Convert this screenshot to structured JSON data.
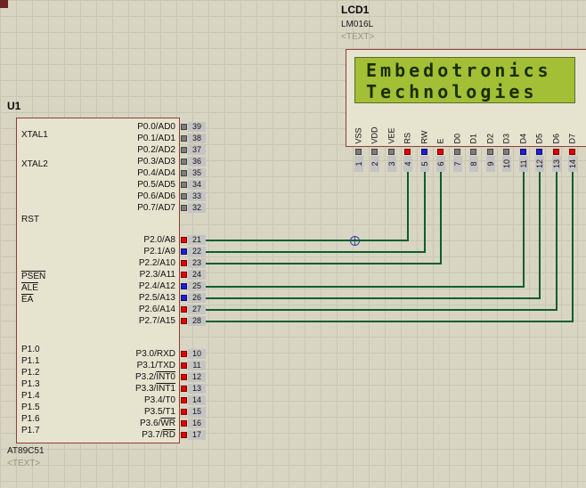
{
  "colors": {
    "background": "#d8d5c2",
    "grid_line": "#c9c6b1",
    "chip_fill": "#e6e3cf",
    "chip_border": "#8e3f38",
    "pin_box": "#c4c4c4",
    "wire_green": "#0b5e2d",
    "state_high": "#e10000",
    "state_low": "#1e1ed2",
    "state_float": "#7d7d7d",
    "lcd_screen": "#a3bf35",
    "lcd_text": "#1a2e05"
  },
  "u1": {
    "ref": "U1",
    "part": "AT89C51",
    "placeholder": "<TEXT>",
    "left_pins": [
      {
        "text": "XTAL1"
      },
      {
        "text": "XTAL2"
      },
      {
        "text": "RST"
      },
      {
        "text": "",
        "bar": "PSEN"
      },
      {
        "text": "",
        "bar": "ALE"
      },
      {
        "text": "",
        "bar": "EA"
      },
      {
        "text": "P1.0"
      },
      {
        "text": "P1.1"
      },
      {
        "text": "P1.2"
      },
      {
        "text": "P1.3"
      },
      {
        "text": "P1.4"
      },
      {
        "text": "P1.5"
      },
      {
        "text": "P1.6"
      },
      {
        "text": "P1.7"
      }
    ],
    "port0": [
      {
        "text": "P0.0/AD0",
        "number": "39",
        "state": "float"
      },
      {
        "text": "P0.1/AD1",
        "number": "38",
        "state": "float"
      },
      {
        "text": "P0.2/AD2",
        "number": "37",
        "state": "float"
      },
      {
        "text": "P0.3/AD3",
        "number": "36",
        "state": "float"
      },
      {
        "text": "P0.4/AD4",
        "number": "35",
        "state": "float"
      },
      {
        "text": "P0.5/AD5",
        "number": "34",
        "state": "float"
      },
      {
        "text": "P0.6/AD6",
        "number": "33",
        "state": "float"
      },
      {
        "text": "P0.7/AD7",
        "number": "32",
        "state": "float"
      }
    ],
    "port2": [
      {
        "text": "P2.0/A8",
        "number": "21",
        "state": "high"
      },
      {
        "text": "P2.1/A9",
        "number": "22",
        "state": "low"
      },
      {
        "text": "P2.2/A10",
        "number": "23",
        "state": "high"
      },
      {
        "text": "P2.3/A11",
        "number": "24",
        "state": "high"
      },
      {
        "text": "P2.4/A12",
        "number": "25",
        "state": "low"
      },
      {
        "text": "P2.5/A13",
        "number": "26",
        "state": "low"
      },
      {
        "text": "P2.6/A14",
        "number": "27",
        "state": "high"
      },
      {
        "text": "P2.7/A15",
        "number": "28",
        "state": "high"
      }
    ],
    "port3": [
      {
        "text": "P3.0/RXD",
        "number": "10",
        "state": "high"
      },
      {
        "text": "P3.1/TXD",
        "number": "11",
        "state": "high"
      },
      {
        "text": "P3.2/",
        "bar": "INT0",
        "number": "12",
        "state": "high"
      },
      {
        "text": "P3.3/",
        "bar": "INT1",
        "number": "13",
        "state": "high"
      },
      {
        "text": "P3.4/T0",
        "number": "14",
        "state": "high"
      },
      {
        "text": "P3.5/T1",
        "number": "15",
        "state": "high"
      },
      {
        "text": "P3.6/",
        "bar": "WR",
        "number": "16",
        "state": "high"
      },
      {
        "text": "P3.7/",
        "bar": "RD",
        "number": "17",
        "state": "high"
      }
    ]
  },
  "lcd": {
    "ref": "LCD1",
    "part": "LM016L",
    "placeholder": "<TEXT>",
    "display_lines": [
      "Embedotronics",
      "Technologies"
    ],
    "pins": [
      {
        "label": "VSS",
        "number": "1",
        "state": "float"
      },
      {
        "label": "VDD",
        "number": "2",
        "state": "float"
      },
      {
        "label": "VEE",
        "number": "3",
        "state": "float"
      },
      {
        "label": "RS",
        "number": "4",
        "state": "high"
      },
      {
        "label": "RW",
        "number": "5",
        "state": "low"
      },
      {
        "label": "E",
        "number": "6",
        "state": "high"
      },
      {
        "label": "D0",
        "number": "7",
        "state": "float"
      },
      {
        "label": "D1",
        "number": "8",
        "state": "float"
      },
      {
        "label": "D2",
        "number": "9",
        "state": "float"
      },
      {
        "label": "D3",
        "number": "10",
        "state": "float"
      },
      {
        "label": "D4",
        "number": "11",
        "state": "low"
      },
      {
        "label": "D5",
        "number": "12",
        "state": "low"
      },
      {
        "label": "D6",
        "number": "13",
        "state": "high"
      },
      {
        "label": "D7",
        "number": "14",
        "state": "high"
      }
    ]
  },
  "wires": [
    {
      "from": "21",
      "to": "4"
    },
    {
      "from": "22",
      "to": "5"
    },
    {
      "from": "23",
      "to": "6"
    },
    {
      "from": "25",
      "to": "11"
    },
    {
      "from": "26",
      "to": "12"
    },
    {
      "from": "27",
      "to": "13"
    },
    {
      "from": "28",
      "to": "14"
    }
  ]
}
